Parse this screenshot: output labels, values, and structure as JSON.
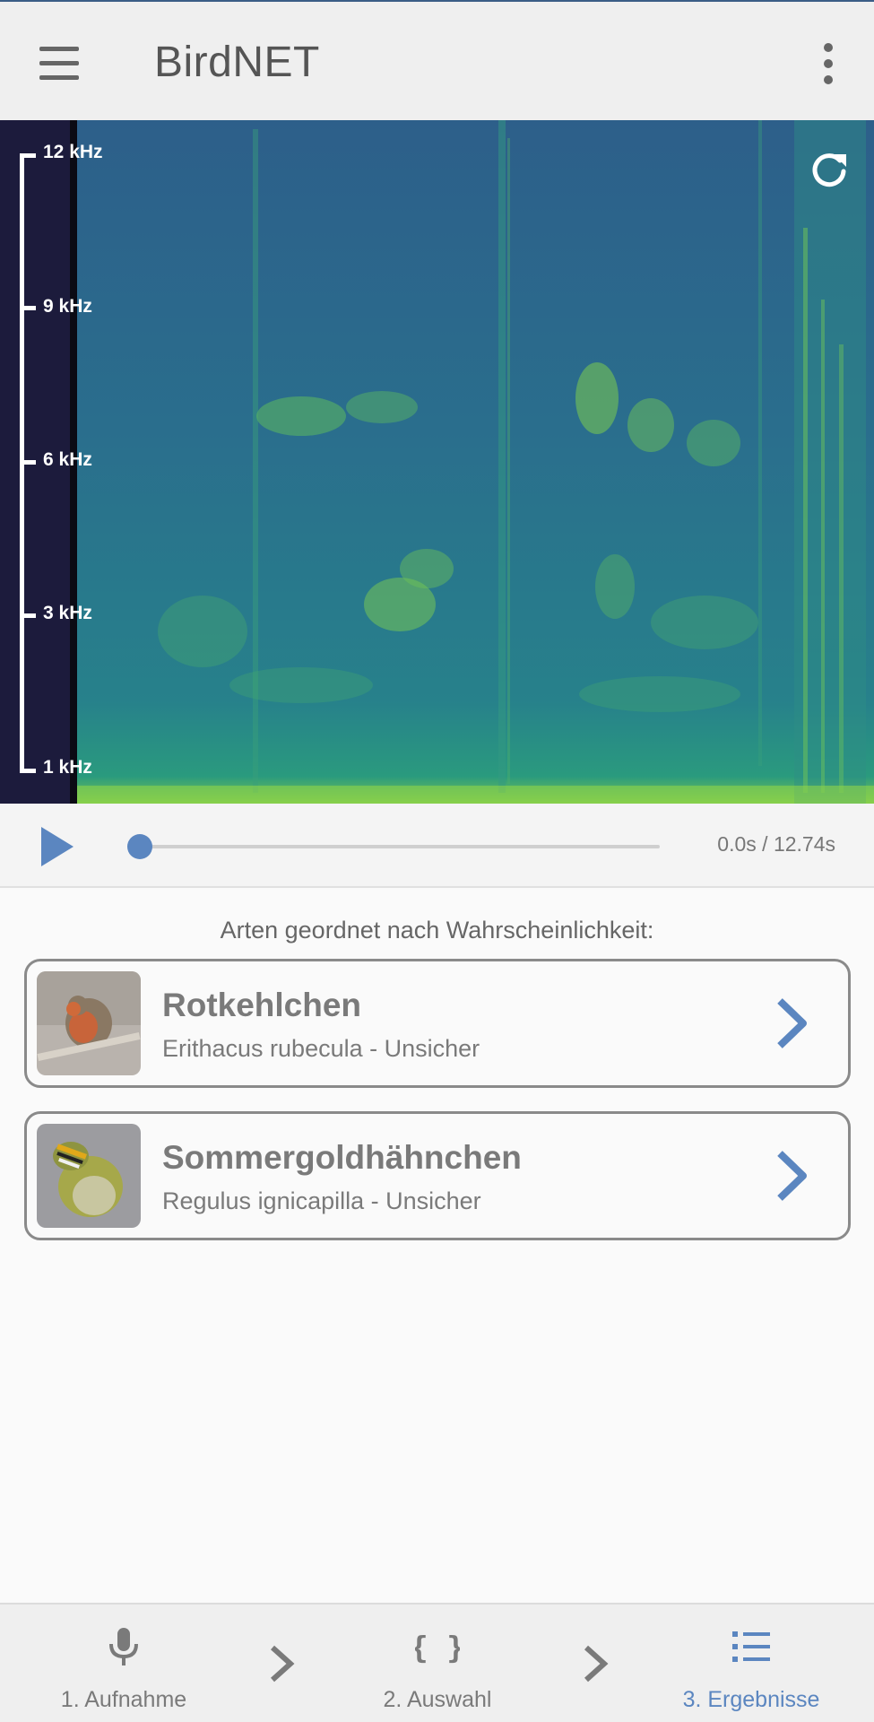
{
  "app": {
    "title": "BirdNET"
  },
  "header": {
    "menu_icon": "hamburger-menu-icon",
    "more_icon": "more-vert-icon"
  },
  "spectrogram": {
    "frequency_labels": [
      "12 kHz",
      "9 kHz",
      "6 kHz",
      "3 kHz",
      "1 kHz"
    ],
    "refresh_icon": "refresh-icon"
  },
  "player": {
    "play_icon": "play-icon",
    "progress": 0.0,
    "time_text": "0.0s / 12.74s"
  },
  "results": {
    "heading": "Arten geordnet nach Wahrscheinlichkeit:",
    "items": [
      {
        "name": "Rotkehlchen",
        "subtitle": "Erithacus rubecula - Unsicher"
      },
      {
        "name": "Sommergoldhähnchen",
        "subtitle": "Regulus ignicapilla - Unsicher"
      }
    ]
  },
  "bottom_nav": {
    "tabs": [
      {
        "label": "1. Aufnahme",
        "icon": "microphone-icon",
        "active": false
      },
      {
        "label": "2. Auswahl",
        "icon": "braces-icon",
        "active": false
      },
      {
        "label": "3. Ergebnisse",
        "icon": "list-icon",
        "active": true
      }
    ]
  },
  "colors": {
    "accent": "#5b86c0",
    "spectrogram_bg": "#2b6a8c",
    "axis_bg": "#1c1b3c"
  }
}
